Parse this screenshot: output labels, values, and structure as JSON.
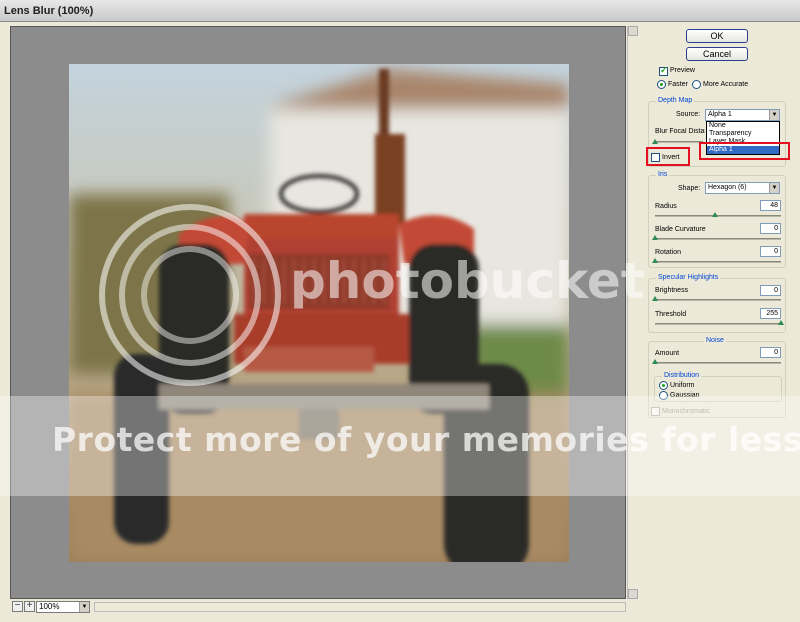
{
  "window": {
    "title": "Lens Blur (100%)"
  },
  "buttons": {
    "ok": "OK",
    "cancel": "Cancel"
  },
  "preview": {
    "label": "Preview",
    "checked": true,
    "faster_label": "Faster",
    "more_accurate_label": "More Accurate",
    "selected": "Faster"
  },
  "depth_map": {
    "title": "Depth Map",
    "source_label": "Source:",
    "source_value": "Alpha 1",
    "source_options": [
      "None",
      "Transparency",
      "Layer Mask",
      "Alpha 1"
    ],
    "focal_label": "Blur Focal Distance",
    "invert_label": "Invert",
    "invert_checked": false
  },
  "iris": {
    "title": "Iris",
    "shape_label": "Shape:",
    "shape_value": "Hexagon (6)",
    "radius_label": "Radius",
    "radius_value": "48",
    "radius_fraction": 0.48,
    "blade_label": "Blade Curvature",
    "blade_value": "0",
    "blade_fraction": 0.0,
    "rotation_label": "Rotation",
    "rotation_value": "0",
    "rotation_fraction": 0.0
  },
  "specular": {
    "title": "Specular Highlights",
    "brightness_label": "Brightness",
    "brightness_value": "0",
    "brightness_fraction": 0.0,
    "threshold_label": "Threshold",
    "threshold_value": "255",
    "threshold_fraction": 1.0
  },
  "noise": {
    "title": "Noise",
    "amount_label": "Amount",
    "amount_value": "0",
    "amount_fraction": 0.0,
    "distribution_title": "Distribution",
    "uniform_label": "Uniform",
    "gaussian_label": "Gaussian",
    "selected": "Uniform",
    "mono_label": "Monochromatic"
  },
  "status": {
    "zoom": "100%",
    "zoom_out": "−",
    "zoom_in": "+"
  },
  "watermark": {
    "logo": "photobucket",
    "tagline": "Protect more of your memories for less!"
  },
  "colors": {
    "highlight_box": "#e3101f",
    "accent": "#0046d5",
    "tractor_red": "#b8442e"
  }
}
